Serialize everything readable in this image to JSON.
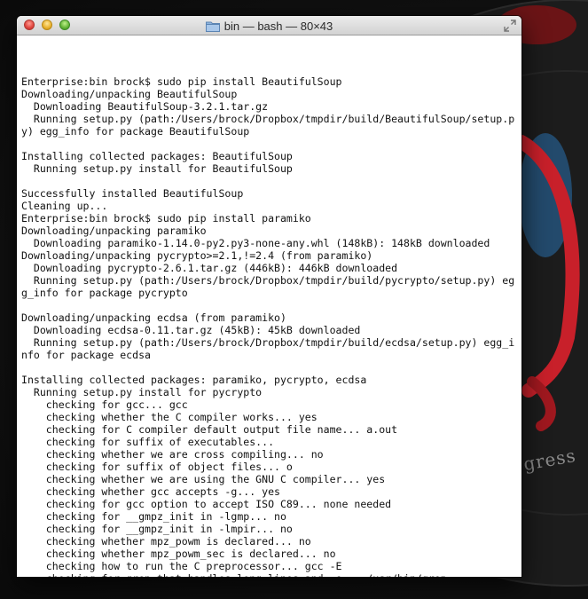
{
  "window": {
    "title": "bin — bash — 80×43"
  },
  "wallpaper": {
    "brand_text": "gress"
  },
  "terminal": {
    "lines": [
      "Enterprise:bin brock$ sudo pip install BeautifulSoup",
      "Downloading/unpacking BeautifulSoup",
      "  Downloading BeautifulSoup-3.2.1.tar.gz",
      "  Running setup.py (path:/Users/brock/Dropbox/tmpdir/build/BeautifulSoup/setup.p",
      "y) egg_info for package BeautifulSoup",
      "",
      "Installing collected packages: BeautifulSoup",
      "  Running setup.py install for BeautifulSoup",
      "",
      "Successfully installed BeautifulSoup",
      "Cleaning up...",
      "Enterprise:bin brock$ sudo pip install paramiko",
      "Downloading/unpacking paramiko",
      "  Downloading paramiko-1.14.0-py2.py3-none-any.whl (148kB): 148kB downloaded",
      "Downloading/unpacking pycrypto>=2.1,!=2.4 (from paramiko)",
      "  Downloading pycrypto-2.6.1.tar.gz (446kB): 446kB downloaded",
      "  Running setup.py (path:/Users/brock/Dropbox/tmpdir/build/pycrypto/setup.py) eg",
      "g_info for package pycrypto",
      "",
      "Downloading/unpacking ecdsa (from paramiko)",
      "  Downloading ecdsa-0.11.tar.gz (45kB): 45kB downloaded",
      "  Running setup.py (path:/Users/brock/Dropbox/tmpdir/build/ecdsa/setup.py) egg_i",
      "nfo for package ecdsa",
      "",
      "Installing collected packages: paramiko, pycrypto, ecdsa",
      "  Running setup.py install for pycrypto",
      "    checking for gcc... gcc",
      "    checking whether the C compiler works... yes",
      "    checking for C compiler default output file name... a.out",
      "    checking for suffix of executables...",
      "    checking whether we are cross compiling... no",
      "    checking for suffix of object files... o",
      "    checking whether we are using the GNU C compiler... yes",
      "    checking whether gcc accepts -g... yes",
      "    checking for gcc option to accept ISO C89... none needed",
      "    checking for __gmpz_init in -lgmp... no",
      "    checking for __gmpz_init in -lmpir... no",
      "    checking whether mpz_powm is declared... no",
      "    checking whether mpz_powm_sec is declared... no",
      "    checking how to run the C preprocessor... gcc -E",
      "    checking for grep that handles long lines and -e... /usr/bin/grep"
    ]
  },
  "colors": {
    "close": "#e0443e",
    "minimize": "#e9b12c",
    "maximize": "#62b336",
    "terminal_bg": "#ffffff",
    "terminal_fg": "#111111"
  },
  "icons": {
    "title_icon": "folder-icon",
    "fullscreen": "fullscreen-icon"
  }
}
